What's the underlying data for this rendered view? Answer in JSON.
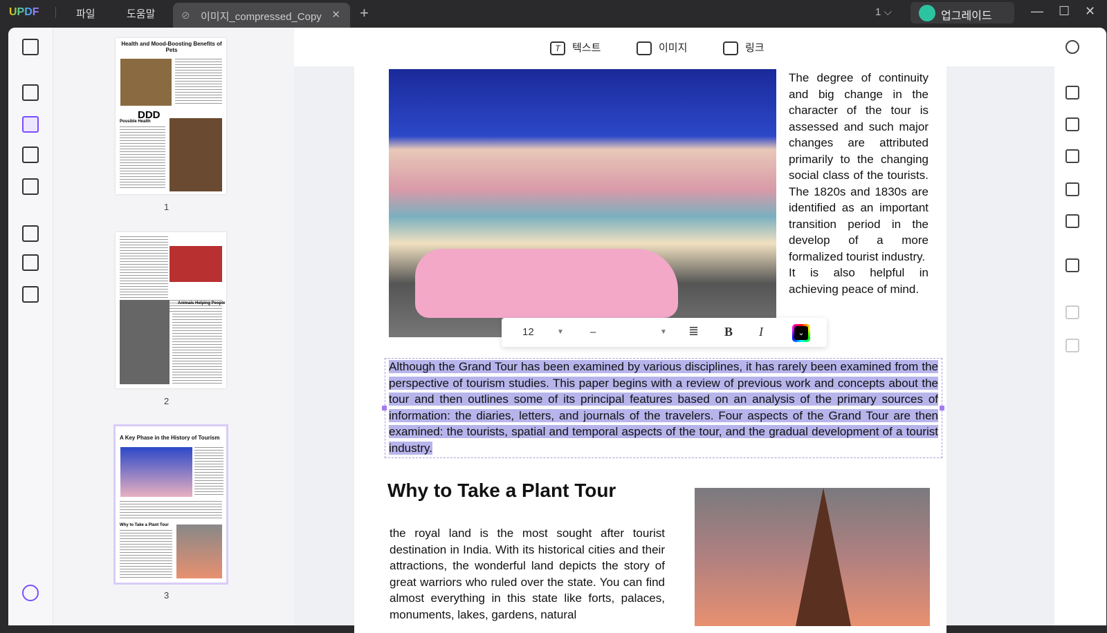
{
  "app": {
    "logo": "UPDF",
    "menu": [
      "파일",
      "도움말"
    ],
    "tab_title": "이미지_compressed_Copy",
    "page_indicator": "1",
    "upgrade": "업그레이드"
  },
  "toolbar": {
    "text": "텍스트",
    "image": "이미지",
    "link": "링크"
  },
  "thumbnails": [
    {
      "page": "1",
      "title": "Health and Mood-Boosting Benefits of Pets",
      "overlay": "DDD",
      "subtitle": "Possible Health"
    },
    {
      "page": "2",
      "subtitle": "Animals Helping People"
    },
    {
      "page": "3",
      "title": "A Key Phase in the History of Tourism",
      "subtitle": "Why to Take a Plant Tour"
    }
  ],
  "format_toolbar": {
    "font_size": "12",
    "font_family": "–"
  },
  "document": {
    "para1": "The degree of continuity and big change in the character of the tour is assessed and such major changes are attributed primarily to the changing social class of the tourists. The 1820s and 1830s are identified as an important transition period in the develop of a more formalized tourist industry.",
    "para1b": "It is also helpful in achieving peace of mind.",
    "selected": "Although the Grand Tour has been examined by various disciplines, it has rarely been examined from the perspective of tourism studies. This paper begins with a review of previous work and concepts about the tour and then outlines some of its principal features based on an analysis of the primary sources of information: the diaries, letters, and journals of the travelers. Four aspects of the Grand Tour are then examined: the tourists, spatial and temporal aspects of the tour, and the gradual development of a tourist industry.",
    "heading": "Why to Take a Plant Tour",
    "para2": "the royal land is the most sought after tourist destination in India. With its historical cities and their attractions, the wonderful land depicts the story of great warriors who ruled over the state. You can find almost everything in this state like forts, palaces, monuments, lakes, gardens, natural"
  }
}
